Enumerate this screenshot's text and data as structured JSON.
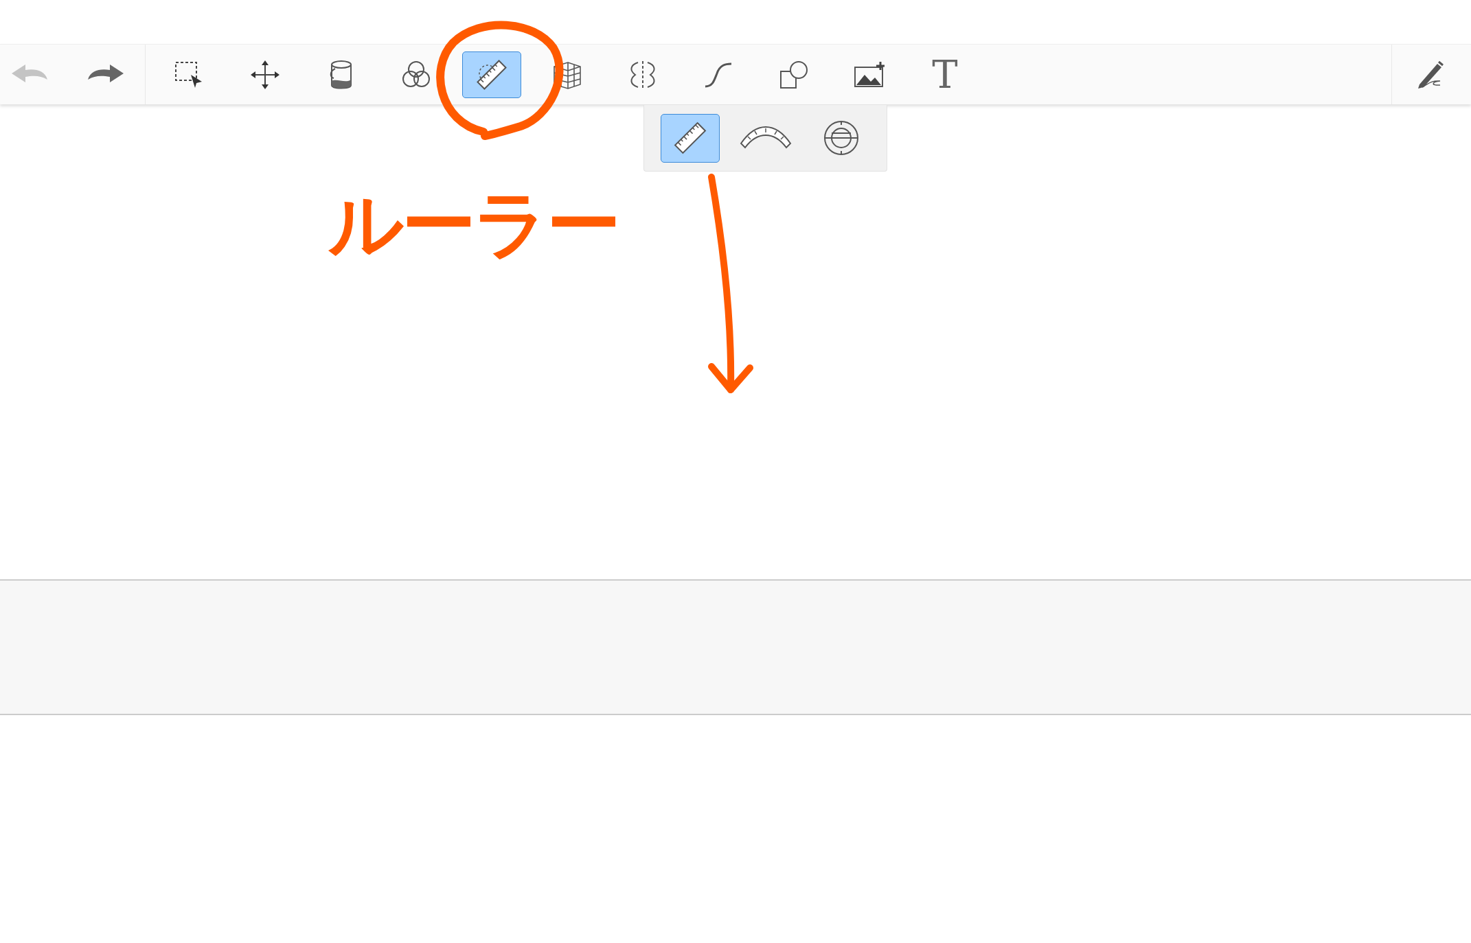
{
  "history": [
    {
      "kind": "undo",
      "disabled": true
    },
    {
      "kind": "redo",
      "disabled": false
    }
  ],
  "tools": [
    {
      "kind": "selection",
      "selected": false
    },
    {
      "kind": "move",
      "selected": false
    },
    {
      "kind": "fill",
      "selected": false
    },
    {
      "kind": "color-mix",
      "selected": false
    },
    {
      "kind": "ruler",
      "selected": true
    },
    {
      "kind": "perspective",
      "selected": false
    },
    {
      "kind": "symmetry",
      "selected": false
    },
    {
      "kind": "curve",
      "selected": false
    },
    {
      "kind": "shapes",
      "selected": false
    },
    {
      "kind": "image",
      "selected": false
    },
    {
      "kind": "text",
      "glyph": "T",
      "selected": false
    }
  ],
  "pen_tool": {
    "selected": false
  },
  "ruler_popup": [
    {
      "kind": "straight",
      "selected": true
    },
    {
      "kind": "arc",
      "selected": false
    },
    {
      "kind": "circle",
      "selected": false
    }
  ],
  "annotation": {
    "label": "ルーラー",
    "color": "#ff5a00"
  }
}
